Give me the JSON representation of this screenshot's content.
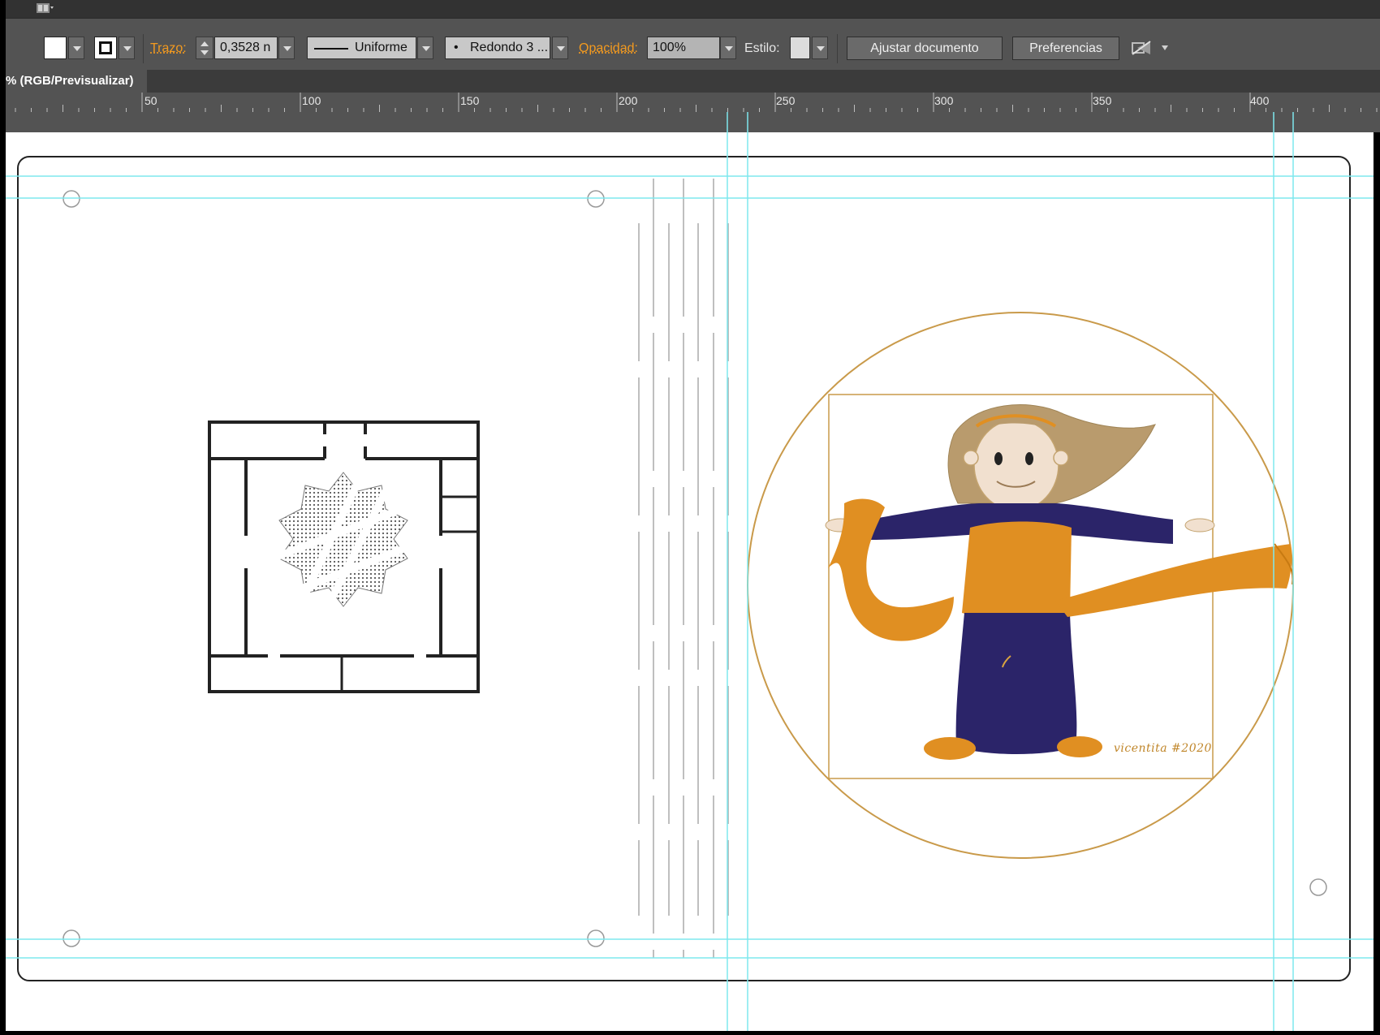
{
  "control_bar": {
    "stroke_label": "Trazo:",
    "stroke_weight": "0,3528 n",
    "profile_label": "Uniforme",
    "brush_label": "Redondo 3 ...",
    "opacity_label": "Opacidad:",
    "opacity_value": "100%",
    "style_label": "Estilo:",
    "document_setup_button": "Ajustar documento",
    "preferences_button": "Preferencias"
  },
  "document_tab": {
    "title": "% (RGB/Previsualizar)"
  },
  "ruler": {
    "ticks": [
      "50",
      "100",
      "150",
      "200",
      "250",
      "300",
      "350",
      "400"
    ]
  },
  "artwork": {
    "signature": "vicentita #2020",
    "colors": {
      "guide": "#7ee8ee",
      "gold": "#c99a4a",
      "orange": "#e08f22",
      "navy": "#2b2469",
      "hair": "#b99b6d",
      "skin": "#f1e0cf"
    }
  }
}
